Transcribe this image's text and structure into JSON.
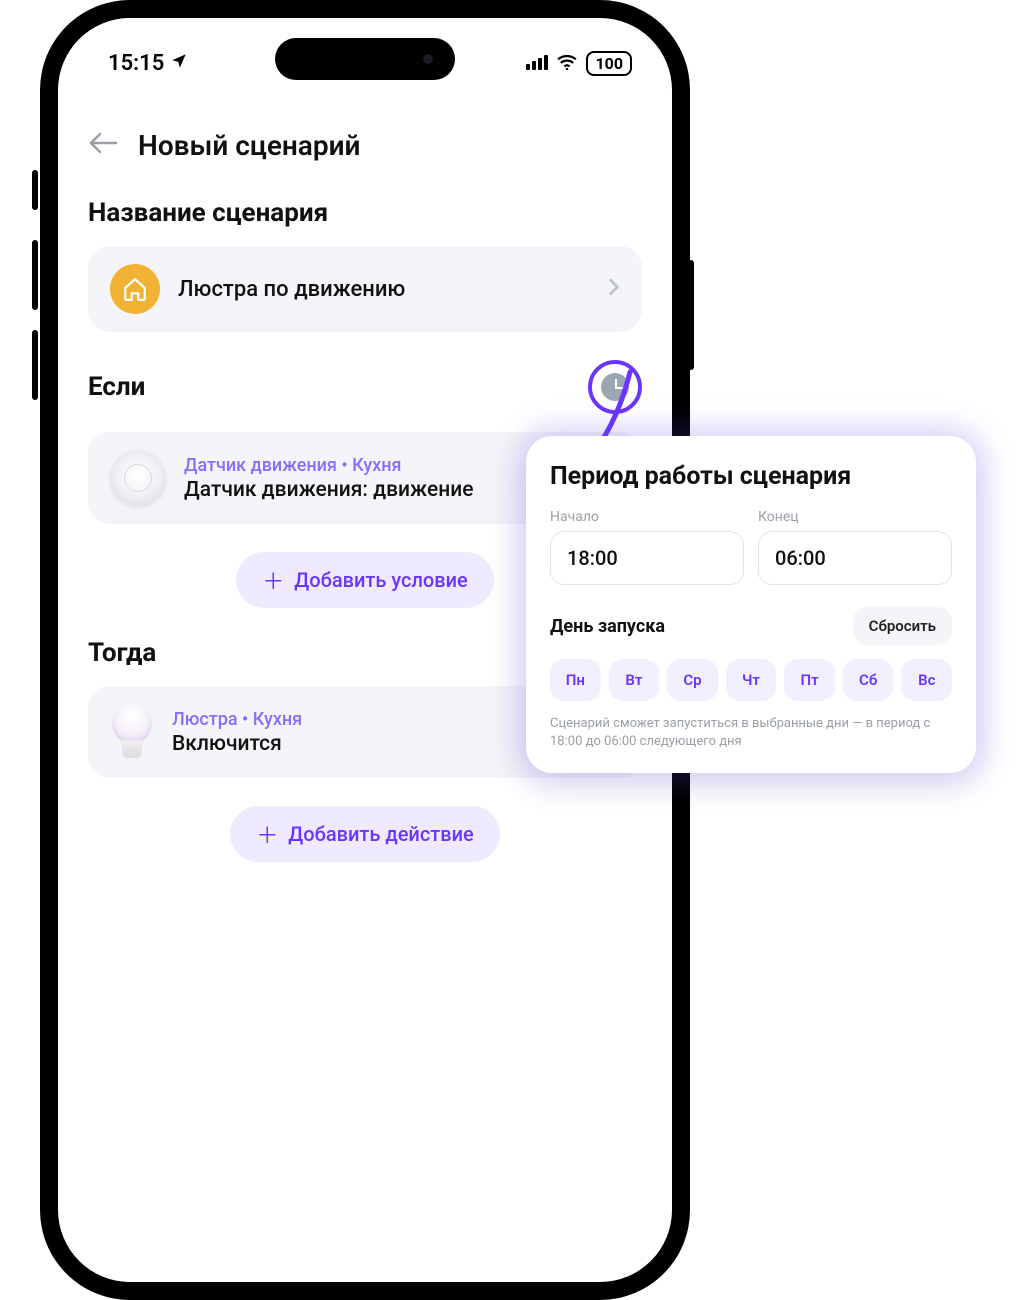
{
  "status": {
    "time": "15:15",
    "battery": "100"
  },
  "header": {
    "title": "Новый сценарий"
  },
  "name_section": {
    "label": "Название сценария",
    "value": "Люстра по движению"
  },
  "if_section": {
    "label": "Если",
    "device_sub": "Датчик движения • Кухня",
    "device_main": "Датчик движения: движение",
    "add": "Добавить условие"
  },
  "then_section": {
    "label": "Тогда",
    "device_sub": "Люстра • Кухня",
    "device_main": "Включится",
    "add": "Добавить действие"
  },
  "popup": {
    "title": "Период работы сценария",
    "start_label": "Начало",
    "start_value": "18:00",
    "end_label": "Конец",
    "end_value": "06:00",
    "launch_label": "День запуска",
    "reset": "Сбросить",
    "days": [
      "Пн",
      "Вт",
      "Ср",
      "Чт",
      "Пт",
      "Сб",
      "Вс"
    ],
    "footnote": "Сценарий сможет запуститься в выбранные дни — в период с 18:00 до 06:00 следующего дня"
  }
}
